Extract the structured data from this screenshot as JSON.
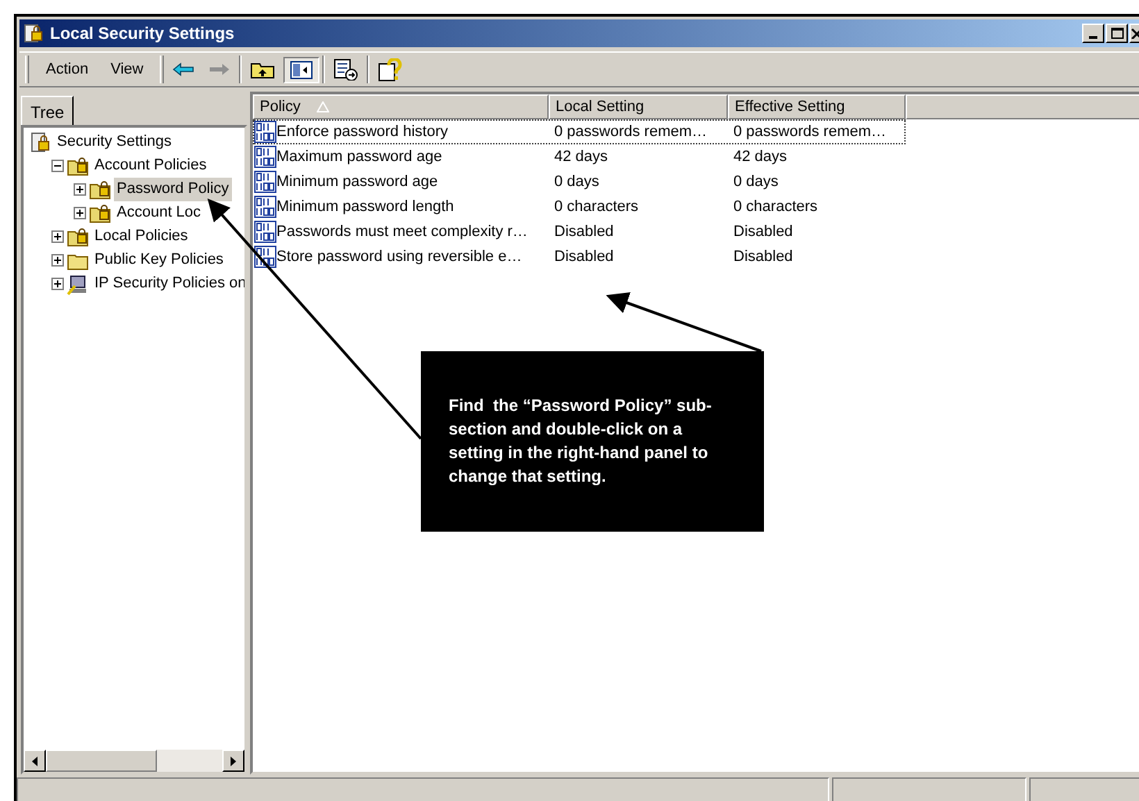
{
  "window": {
    "title": "Local Security Settings"
  },
  "menu": [
    {
      "label": "Action"
    },
    {
      "label": "View"
    }
  ],
  "tree_tab": {
    "label": "Tree"
  },
  "tree": [
    {
      "label": "Security Settings",
      "kind": "root",
      "selected": false,
      "children": [
        {
          "label": "Account Policies",
          "kind": "locked",
          "expanded": true,
          "selected": false,
          "children": [
            {
              "label": "Password Policy",
              "kind": "locked",
              "expanded": false,
              "selected": true
            },
            {
              "label": "Account Loc",
              "kind": "locked",
              "expanded": false,
              "selected": false
            }
          ]
        },
        {
          "label": "Local Policies",
          "kind": "locked",
          "expanded": false,
          "selected": false
        },
        {
          "label": "Public Key Policies",
          "kind": "folder",
          "expanded": false,
          "selected": false
        },
        {
          "label": "IP Security Policies on",
          "kind": "computer",
          "expanded": false,
          "selected": false
        }
      ]
    }
  ],
  "table": {
    "columns": [
      "Policy",
      "Local Setting",
      "Effective Setting"
    ],
    "rows": [
      {
        "policy": "Enforce password history",
        "local": "0 passwords remem…",
        "effective": "0 passwords remem…",
        "focused": true
      },
      {
        "policy": "Maximum password age",
        "local": "42 days",
        "effective": "42 days",
        "focused": false
      },
      {
        "policy": "Minimum password age",
        "local": "0 days",
        "effective": "0 days",
        "focused": false
      },
      {
        "policy": "Minimum password length",
        "local": "0 characters",
        "effective": "0 characters",
        "focused": false
      },
      {
        "policy": "Passwords must meet complexity r…",
        "local": "Disabled",
        "effective": "Disabled",
        "focused": false
      },
      {
        "policy": "Store password using reversible e…",
        "local": "Disabled",
        "effective": "Disabled",
        "focused": false
      }
    ]
  },
  "callout": {
    "text": "Find  the “Password Policy” sub-section and double-click on a setting in the right-hand panel to change that setting."
  }
}
